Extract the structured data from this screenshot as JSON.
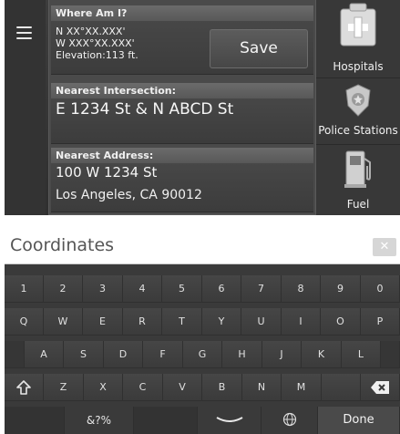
{
  "top_screen": {
    "where_am_i_header": "Where Am I?",
    "latitude": "N XX°XX.XXX'",
    "longitude": "W XXX°XX.XXX'",
    "elevation": "Elevation:113 ft.",
    "save_label": "Save",
    "intersection_header": "Nearest Intersection:",
    "intersection_value": "E 1234 St & N ABCD St",
    "address_header": "Nearest Address:",
    "address_line1": "100 W 1234 St",
    "address_line2": "Los Angeles, CA 90012",
    "side": {
      "hospitals": "Hospitals",
      "police": "Police Stations",
      "fuel": "Fuel"
    }
  },
  "keyboard_screen": {
    "input_text": "Coordinates",
    "clear_label": "✕",
    "row1": [
      "1",
      "2",
      "3",
      "4",
      "5",
      "6",
      "7",
      "8",
      "9",
      "0"
    ],
    "row2": [
      "Q",
      "W",
      "E",
      "R",
      "T",
      "Y",
      "U",
      "I",
      "O",
      "P"
    ],
    "row3": [
      "A",
      "S",
      "D",
      "F",
      "G",
      "H",
      "J",
      "K",
      "L"
    ],
    "row4": [
      "Z",
      "X",
      "C",
      "V",
      "B",
      "N",
      "M"
    ],
    "symbols_label": "&?%",
    "done_label": "Done"
  },
  "colors": {
    "screen_bg": "#3a3a3a",
    "header_bg": "#5f5f5f",
    "text": "#f2f2f2"
  }
}
